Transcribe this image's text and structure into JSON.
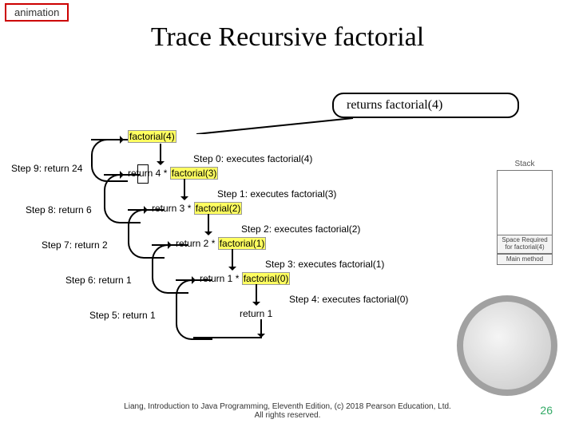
{
  "tag": "animation",
  "title": "Trace Recursive factorial",
  "bubble": "returns factorial(4)",
  "top_call": "factorial(4)",
  "steps_right": [
    "Step 0: executes factorial(4)",
    "Step 1: executes factorial(3)",
    "Step 2: executes factorial(2)",
    "Step 3: executes factorial(1)",
    "Step 4: executes factorial(0)"
  ],
  "steps_left": [
    "Step 9: return 24",
    "Step 8: return 6",
    "Step 7: return 2",
    "Step 6: return 1",
    "Step 5: return 1"
  ],
  "returns": [
    {
      "pre": "return 4 * ",
      "hl": "factorial(3)"
    },
    {
      "pre": "return 3 * ",
      "hl": "factorial(2)"
    },
    {
      "pre": "return 2 * ",
      "hl": "factorial(1)"
    },
    {
      "pre": "return 1 * ",
      "hl": "factorial(0)"
    },
    {
      "pre": "return 1",
      "hl": ""
    }
  ],
  "stack": {
    "label": "Stack",
    "cells": [
      "Space Required for factorial(4)",
      "Main method"
    ]
  },
  "footer1": "Liang, Introduction to Java Programming, Eleventh Edition, (c) 2018 Pearson Education, Ltd.",
  "footer2": "All rights reserved.",
  "pagenum": "26"
}
